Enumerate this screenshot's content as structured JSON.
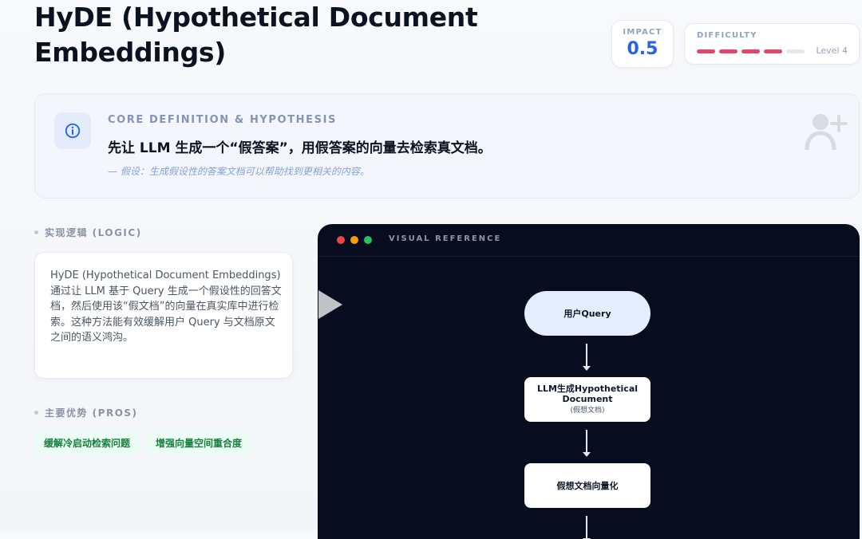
{
  "title": {
    "line1": "HyDE (Hypothetical Document",
    "line2": "Embeddings)"
  },
  "impact": {
    "label": "IMPACT",
    "value": "0.5"
  },
  "difficulty": {
    "label": "DIFFICULTY",
    "level_text": "Level 4",
    "level": 4,
    "max_level": 5,
    "color": "#e0456a"
  },
  "definition": {
    "label": "CORE DEFINITION & HYPOTHESIS",
    "main": "先让 LLM 生成一个“假答案”，用假答案的向量去检索真文档。",
    "hypothesis": "— 假设：生成假设性的答案文档可以帮助找到更相关的内容。"
  },
  "logic": {
    "label": "实现逻辑 (LOGIC)",
    "text": "HyDE (Hypothetical Document Embeddings) 通过让 LLM 基于 Query 生成一个假设性的回答文档，然后使用该“假文档”的向量在真实库中进行检索。这种方法能有效缓解用户 Query 与文档原文之间的语义鸿沟。"
  },
  "pros": {
    "label": "主要优势 (PROS)",
    "items": [
      "缓解冷启动检索问题",
      "增强向量空间重合度"
    ]
  },
  "visual": {
    "title": "VISUAL REFERENCE",
    "nodes": {
      "user": "用户Query",
      "llm_line1": "LLM生成Hypothetical",
      "llm_line2": "Document",
      "llm_sub": "(假想文档)",
      "vector": "假想文档向量化"
    }
  },
  "icons": [
    "info-icon",
    "add-user-icon",
    "play-icon"
  ],
  "colors": {
    "accent": "#2563eb",
    "panel_bg": "#070d1e",
    "pros_text": "#15803d"
  }
}
